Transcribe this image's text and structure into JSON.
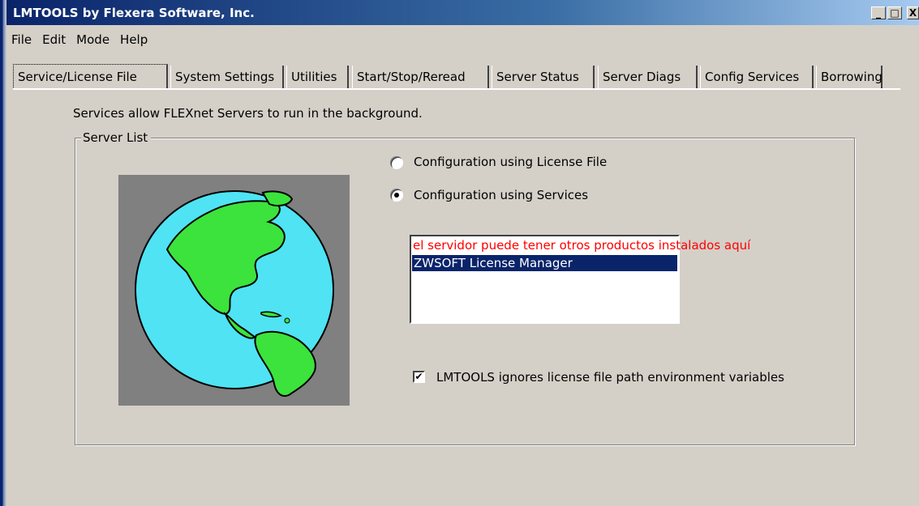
{
  "window": {
    "title": "LMTOOLS by Flexera Software, Inc.",
    "buttons": [
      "_",
      "□",
      "X"
    ]
  },
  "menu": [
    "File",
    "Edit",
    "Mode",
    "Help"
  ],
  "tabs": [
    {
      "label": "Service/License File",
      "active": true
    },
    {
      "label": "System Settings"
    },
    {
      "label": "Utilities"
    },
    {
      "label": "Start/Stop/Reread"
    },
    {
      "label": "Server Status"
    },
    {
      "label": "Server Diags"
    },
    {
      "label": "Config Services"
    },
    {
      "label": "Borrowing"
    }
  ],
  "description": "Services allow FLEXnet Servers to run in the background.",
  "server_list": {
    "label": "Server List",
    "options": [
      {
        "label": "Configuration using License File",
        "selected": false
      },
      {
        "label": "Configuration using Services",
        "selected": true
      }
    ],
    "services": {
      "annotation": "el servidor puede tener otros productos instalados aquí",
      "items": [
        "ZWSOFT License Manager"
      ],
      "selected": "ZWSOFT License Manager"
    },
    "ignore_env_label": "LMTOOLS ignores license file path environment variables",
    "ignore_env_checked": true
  },
  "colors": {
    "titlebar": "#0a246a",
    "selection": "#0a246a",
    "annotation": "#ff0000",
    "globe_ocean": "#4fe3f4",
    "globe_land": "#3ce33c"
  },
  "icons": {
    "globe": "globe-icon",
    "check": "✔"
  }
}
